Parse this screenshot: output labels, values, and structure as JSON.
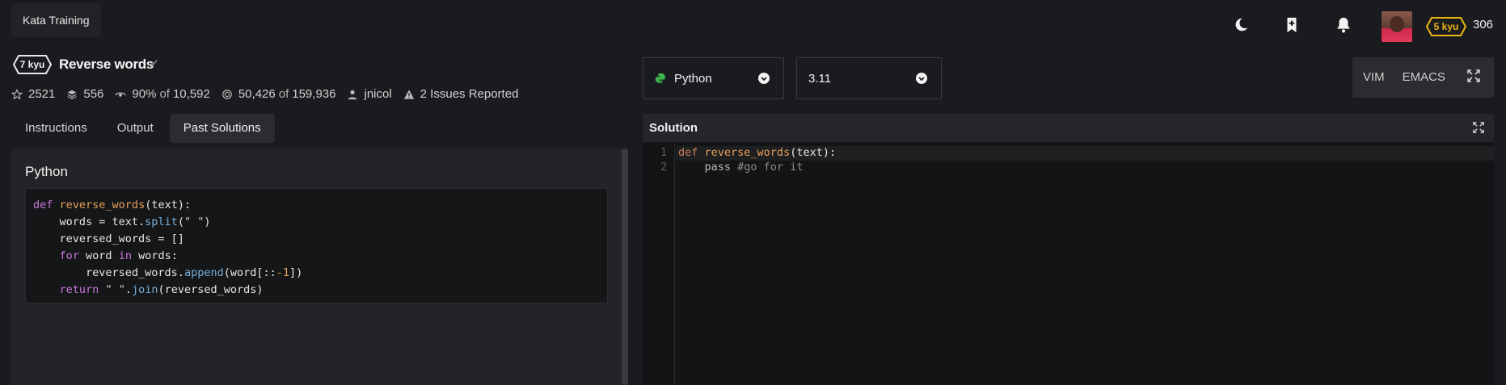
{
  "header": {
    "kata_training": "Kata Training",
    "rank": "5 kyu",
    "honor": "306",
    "rank_color": "#ecb613"
  },
  "kata": {
    "kyu": "7 kyu",
    "title": "Reverse words",
    "stats": {
      "stars": "2521",
      "collections": "556",
      "satisfaction": "90%",
      "satisfaction_of": "of",
      "votes": "10,592",
      "completed": "50,426",
      "completed_of": "of",
      "attempts": "159,936",
      "author": "jnicol",
      "issues": "2 Issues Reported"
    }
  },
  "tabs": [
    {
      "label": "Instructions",
      "active": false
    },
    {
      "label": "Output",
      "active": false
    },
    {
      "label": "Past Solutions",
      "active": true
    }
  ],
  "past_solution": {
    "language": "Python"
  },
  "editor_controls": {
    "language": "Python",
    "version": "3.11",
    "modes": [
      "VIM",
      "EMACS"
    ]
  },
  "solution": {
    "title": "Solution",
    "line_numbers": [
      "1",
      "2"
    ]
  }
}
